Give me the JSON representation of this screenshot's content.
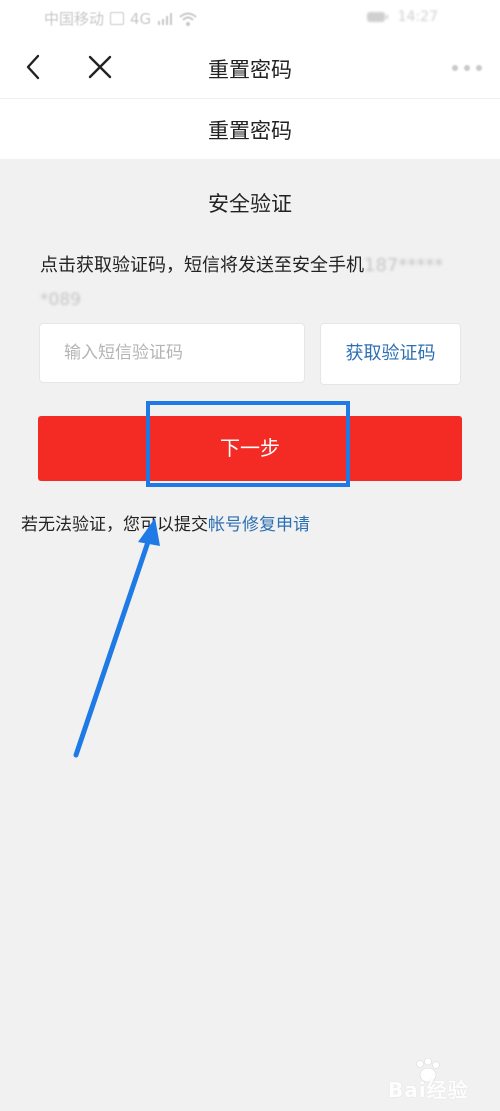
{
  "status_bar": {
    "carrier": "中国移动",
    "net_badge": "4G",
    "time": "14:27"
  },
  "nav": {
    "title": "重置密码"
  },
  "subheader": {
    "title": "重置密码"
  },
  "verify": {
    "section_title": "安全验证",
    "hint_text": "点击获取验证码，短信将发送至安全手机",
    "masked_phone_part1": "187*****",
    "masked_phone_part2": "*089",
    "code_placeholder": "输入短信验证码",
    "get_code_label": "获取验证码",
    "next_label": "下一步",
    "repair_prefix": "若无法验证，您可以提交",
    "repair_link": "帐号修复申请"
  },
  "watermark": {
    "text": "Bai经验"
  },
  "colors": {
    "primary_red": "#f42a24",
    "link_blue": "#2c6fb3",
    "annotation_blue": "#1f7ae6",
    "background": "#f1f1f1"
  }
}
